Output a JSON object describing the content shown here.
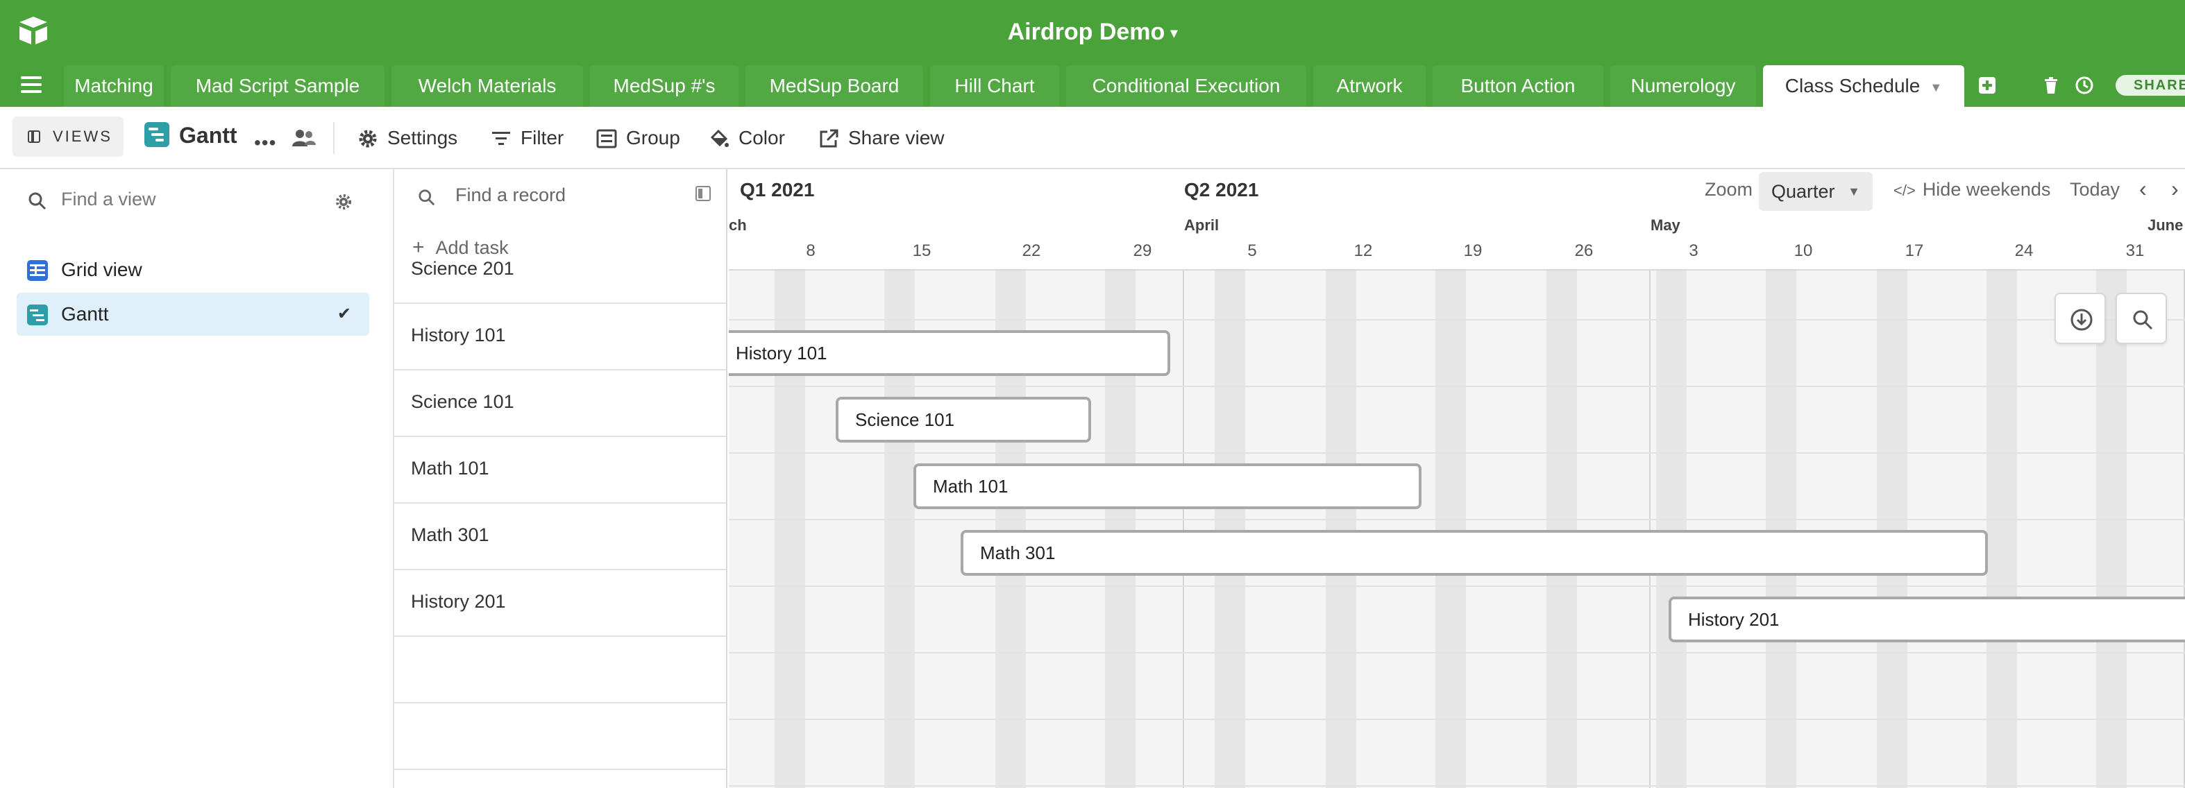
{
  "app": {
    "base_title": "Airdrop Demo"
  },
  "tabs": [
    {
      "label": "Matching",
      "active": false
    },
    {
      "label": "Mad Script Sample",
      "active": false
    },
    {
      "label": "Welch Materials",
      "active": false
    },
    {
      "label": "MedSup #'s",
      "active": false
    },
    {
      "label": "MedSup Board",
      "active": false
    },
    {
      "label": "Hill Chart",
      "active": false
    },
    {
      "label": "Conditional Execution",
      "active": false
    },
    {
      "label": "Atrwork",
      "active": false
    },
    {
      "label": "Button Action",
      "active": false
    },
    {
      "label": "Numerology",
      "active": false
    },
    {
      "label": "Class Schedule",
      "active": true
    }
  ],
  "share_label": "SHARE",
  "viewbar": {
    "views_label": "VIEWS",
    "current_view": "Gantt",
    "tools": [
      "Settings",
      "Filter",
      "Group",
      "Color",
      "Share view"
    ]
  },
  "sidebar": {
    "search_placeholder": "Find a view",
    "views": [
      {
        "label": "Grid view",
        "active": false
      },
      {
        "label": "Gantt",
        "active": true
      }
    ]
  },
  "gantt": {
    "search_placeholder": "Find a record",
    "add_task_label": "Add task",
    "records": [
      "Science 201",
      "History 101",
      "Science 101",
      "Math 101",
      "Math 301",
      "History 201"
    ],
    "timeline": {
      "quarters": [
        "Q1 2021",
        "Q2 2021"
      ],
      "months": [
        "ch",
        "April",
        "May",
        "June"
      ],
      "days": [
        "8",
        "15",
        "22",
        "29",
        "5",
        "12",
        "19",
        "26",
        "3",
        "10",
        "17",
        "24",
        "31"
      ],
      "zoom_label": "Zoom",
      "zoom_value": "Quarter",
      "hide_weekends_label": "Hide weekends",
      "today_label": "Today"
    },
    "tasks": [
      {
        "label": "History 101",
        "start": "2021-03-01",
        "end": "2021-03-31"
      },
      {
        "label": "Science 101",
        "start": "2021-03-10",
        "end": "2021-03-25"
      },
      {
        "label": "Math 101",
        "start": "2021-03-17",
        "end": "2021-04-15"
      },
      {
        "label": "Math 301",
        "start": "2021-03-21",
        "end": "2021-05-25"
      },
      {
        "label": "History 201",
        "start": "2021-05-03",
        "end": "2021-06-05"
      }
    ]
  },
  "colors": {
    "header_green": "#4aa23a",
    "grid_view_icon": "#2f6fd6",
    "gantt_icon": "#2e9fa6",
    "active_view_bg": "#e0f0fb"
  }
}
